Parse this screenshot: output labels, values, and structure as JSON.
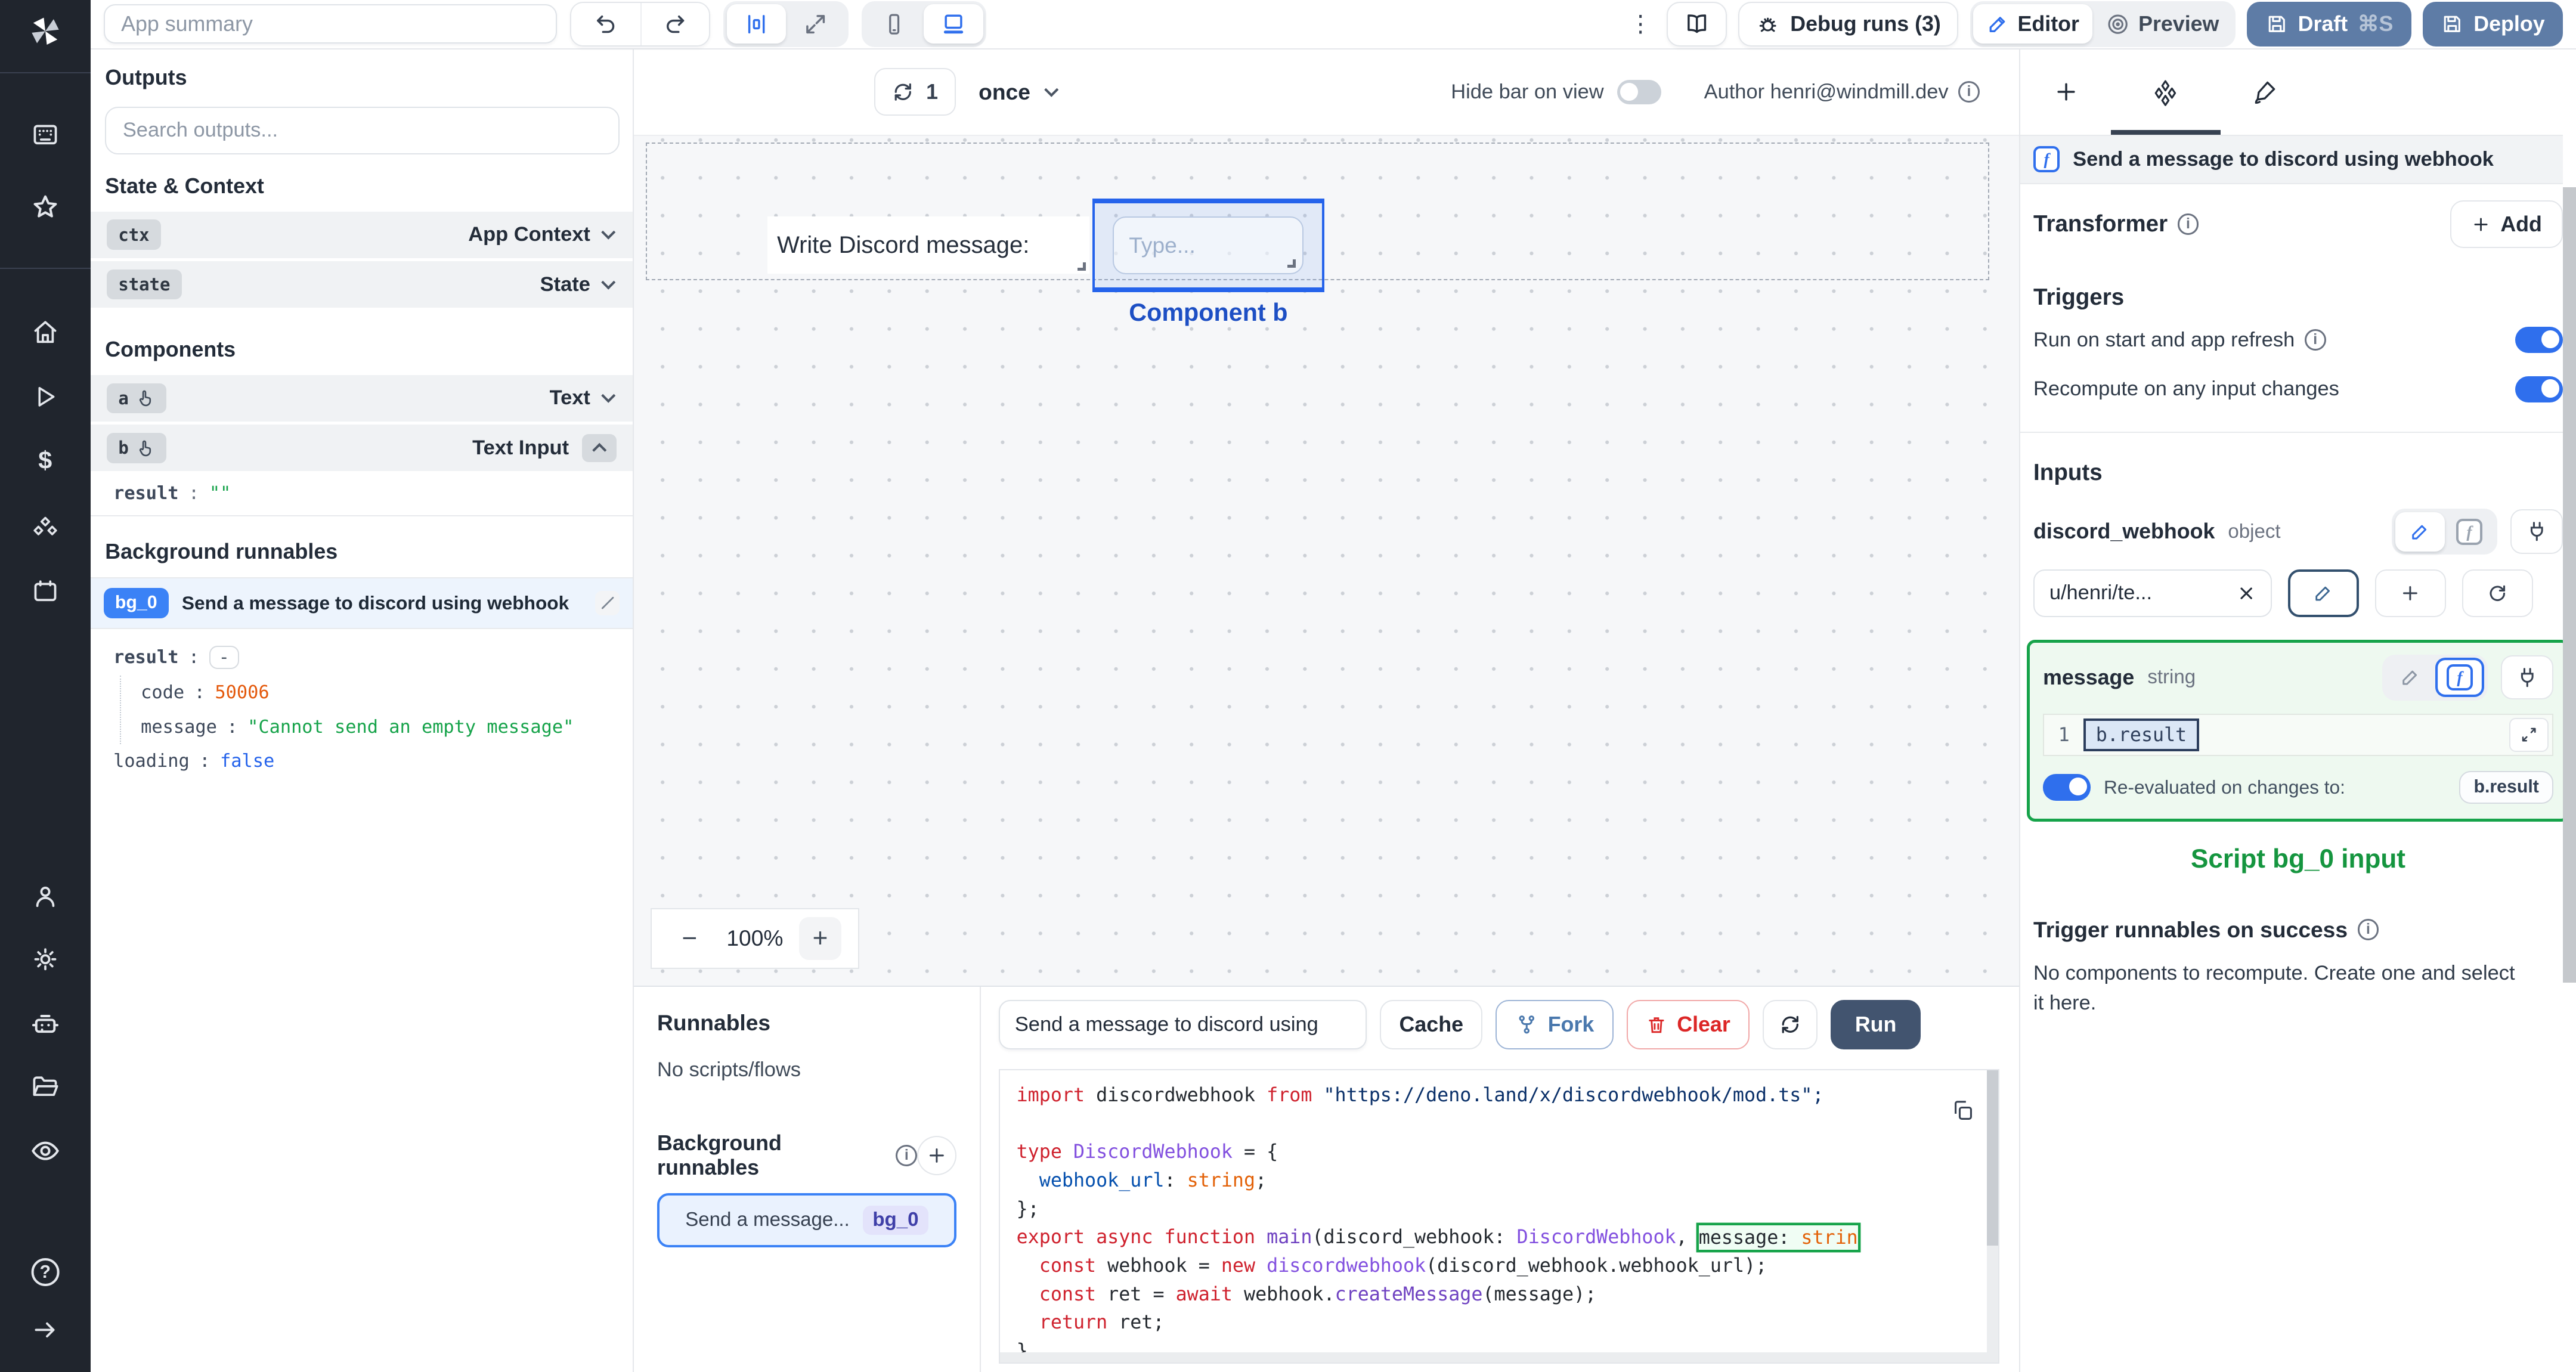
{
  "colors": {
    "accent": "#3b82f6",
    "success_green": "#16a34a",
    "danger_red": "#dc2626",
    "draft_button": "#5e7ca6",
    "run_button": "#42546f"
  },
  "topbar": {
    "app_summary_placeholder": "App summary",
    "kebab": "⋮",
    "debug_label": "Debug runs (3)",
    "editor_label": "Editor",
    "preview_label": "Preview",
    "draft_label": "Draft",
    "draft_shortcut": "⌘S",
    "deploy_label": "Deploy"
  },
  "left_panel": {
    "outputs_title": "Outputs",
    "search_placeholder": "Search outputs...",
    "state_context_title": "State & Context",
    "context_rows": [
      {
        "key": "ctx",
        "type": "App Context"
      },
      {
        "key": "state",
        "type": "State"
      }
    ],
    "components_title": "Components",
    "component_rows": [
      {
        "key": "a",
        "type": "Text"
      },
      {
        "key": "b",
        "type": "Text Input"
      }
    ],
    "b_expanded": {
      "key": "result",
      "value": "\"\""
    },
    "background_title": "Background runnables",
    "bg0": {
      "badge": "bg_0",
      "title": "Send a message to discord using webhook"
    },
    "bg0_tree": {
      "result_key": "result",
      "result_value": "-",
      "code_key": "code",
      "code_value": "50006",
      "message_key": "message",
      "message_value": "\"Cannot send an empty message\"",
      "loading_key": "loading",
      "loading_value": "false"
    }
  },
  "canvas": {
    "refresh_count": "1",
    "mode_label": "once",
    "hide_bar_label": "Hide bar on view",
    "author_label": "Author henri@windmill.dev",
    "text_component": "Write Discord message:",
    "input_placeholder": "Type...",
    "selected_component_label": "Component b",
    "zoom_out": "−",
    "zoom_level": "100%",
    "zoom_in": "+"
  },
  "runnables": {
    "title": "Runnables",
    "empty_label": "No scripts/flows",
    "background_title": "Background runnables",
    "item_title": "Send a message...",
    "item_badge": "bg_0"
  },
  "editor": {
    "name_value": "Send a message to discord using",
    "cache_label": "Cache",
    "fork_label": "Fork",
    "clear_label": "Clear",
    "run_label": "Run"
  },
  "code": {
    "lines": [
      [
        [
          "kw",
          "import "
        ],
        [
          "id",
          "discordwebhook "
        ],
        [
          "kw",
          "from "
        ],
        [
          "str",
          "\"https://deno.land/x/discordwebhook/mod.ts\";"
        ]
      ],
      [],
      [
        [
          "kw",
          "type "
        ],
        [
          "type",
          "DiscordWebhook "
        ],
        [
          "pl",
          "= {"
        ]
      ],
      [
        [
          "prop",
          "  webhook_url"
        ],
        [
          "pl",
          ": "
        ],
        [
          "orange",
          "string"
        ],
        [
          "pl",
          ";"
        ]
      ],
      [
        [
          "pl",
          "};"
        ]
      ],
      [
        [
          "kw",
          "export "
        ],
        [
          "kw",
          "async "
        ],
        [
          "kw",
          "function "
        ],
        [
          "fn",
          "main"
        ],
        [
          "pl",
          "("
        ],
        [
          "id",
          "discord_webhook"
        ],
        [
          "pl",
          ": "
        ],
        [
          "type",
          "DiscordWebhook"
        ],
        [
          "pl",
          ", "
        ],
        {
          "hl": [
            [
              "id",
              "message"
            ],
            [
              "pl",
              ": "
            ],
            [
              "orange",
              "strin"
            ]
          ]
        }
      ],
      [
        [
          "kw",
          "  const "
        ],
        [
          "id",
          "webhook "
        ],
        [
          "pl",
          "= "
        ],
        [
          "kw",
          "new "
        ],
        [
          "type",
          "discordwebhook"
        ],
        [
          "pl",
          "("
        ],
        [
          "id",
          "discord_webhook"
        ],
        [
          "pl",
          "."
        ],
        [
          "id",
          "webhook_url"
        ],
        [
          "pl",
          ");"
        ]
      ],
      [
        [
          "kw",
          "  const "
        ],
        [
          "id",
          "ret "
        ],
        [
          "pl",
          "= "
        ],
        [
          "kw",
          "await "
        ],
        [
          "id",
          "webhook"
        ],
        [
          "pl",
          "."
        ],
        [
          "fn",
          "createMessage"
        ],
        [
          "pl",
          "("
        ],
        [
          "id",
          "message"
        ],
        [
          "pl",
          ");"
        ]
      ],
      [
        [
          "kw",
          "  return "
        ],
        [
          "id",
          "ret"
        ],
        [
          "pl",
          ";"
        ]
      ],
      [
        [
          "pl",
          "}"
        ]
      ]
    ]
  },
  "right_panel": {
    "header_title": "Send a message to discord using webhook",
    "transformer_label": "Transformer",
    "add_label": "Add",
    "triggers_title": "Triggers",
    "trigger_rows": [
      "Run on start and app refresh",
      "Recompute on any input changes"
    ],
    "inputs_title": "Inputs",
    "discord_webhook": {
      "name": "discord_webhook",
      "type": "object",
      "value": "u/henri/te..."
    },
    "message": {
      "name": "message",
      "type": "string",
      "line_no": "1",
      "value": "b.result",
      "reeval_label": "Re-evaluated on changes to:",
      "reeval_target": "b.result"
    },
    "script_input_label": "Script bg_0 input",
    "trigger_success_title": "Trigger runnables on success",
    "empty_text": "No components to recompute. Create one and select it here."
  }
}
